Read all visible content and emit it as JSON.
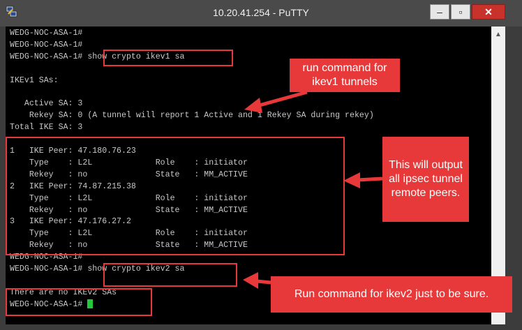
{
  "window": {
    "title": "10.20.41.254 - PuTTY",
    "min_glyph": "‒",
    "max_glyph": "▫",
    "close_glyph": "✕"
  },
  "terminal": {
    "lines": [
      "WEDG-NOC-ASA-1#",
      "WEDG-NOC-ASA-1#",
      "WEDG-NOC-ASA-1# show crypto ikev1 sa",
      "",
      "IKEv1 SAs:",
      "",
      "   Active SA: 3",
      "    Rekey SA: 0 (A tunnel will report 1 Active and 1 Rekey SA during rekey)",
      "Total IKE SA: 3",
      "",
      "1   IKE Peer: 47.180.76.23",
      "    Type    : L2L             Role    : initiator",
      "    Rekey   : no              State   : MM_ACTIVE",
      "2   IKE Peer: 74.87.215.38",
      "    Type    : L2L             Role    : initiator",
      "    Rekey   : no              State   : MM_ACTIVE",
      "3   IKE Peer: 47.176.27.2",
      "    Type    : L2L             Role    : initiator",
      "    Rekey   : no              State   : MM_ACTIVE",
      "WEDG-NOC-ASA-1#",
      "WEDG-NOC-ASA-1# show crypto ikev2 sa",
      "",
      "There are no IKEv2 SAs",
      "WEDG-NOC-ASA-1# "
    ],
    "cursor_color": "#22c93a"
  },
  "annotations": {
    "callout_ikev1": "run command for ikev1 tunnels",
    "callout_peers": "This will output all ipsec tunnel remote peers.",
    "callout_ikev2": "Run command for ikev2 just to be sure.",
    "accent_color": "#e8393a"
  }
}
